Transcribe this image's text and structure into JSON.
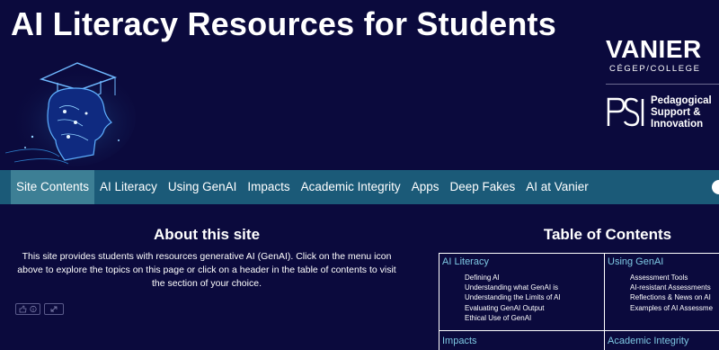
{
  "header": {
    "title": "AI Literacy Resources for Students"
  },
  "brand": {
    "vanier_word": "VANIER",
    "vanier_sub": "CÉGEP/COLLEGE",
    "psi_line1": "Pedagogical",
    "psi_line2": "Support &",
    "psi_line3": "Innovation"
  },
  "nav": {
    "items": [
      "Site Contents",
      "AI Literacy",
      "Using GenAI",
      "Impacts",
      "Academic Integrity",
      "Apps",
      "Deep Fakes",
      "AI at Vanier"
    ]
  },
  "about": {
    "title": "About this site",
    "body": "This site provides students with resources generative AI (GenAI). Click on the menu icon above to explore the topics on this page or click on a header in the table of contents to visit the section of your choice."
  },
  "toc": {
    "title": "Table of Contents",
    "sections": [
      {
        "heading": "AI Literacy",
        "items": [
          "Defining AI",
          "Understanding what GenAI is",
          "Understanding the Limits of AI",
          "Evaluating GenAI Output",
          "Ethical Use of GenAI"
        ]
      },
      {
        "heading": "Using GenAI",
        "items": [
          "Assessment Tools",
          "AI-resistant Assessments",
          "Reflections & News on AI",
          "Examples of AI Assessme"
        ]
      },
      {
        "heading": "Impacts",
        "items": []
      },
      {
        "heading": "Academic Integrity",
        "items": []
      }
    ]
  },
  "colors": {
    "background": "#0b0a3d",
    "navbar": "#1b5a78",
    "nav_active": "#3d7f95",
    "toc_heading": "#7ec8e3"
  },
  "icons": [
    "ai-head-hero-image",
    "thumbs-up-icon",
    "info-icon",
    "expand-icon",
    "menu-toggle-icon"
  ]
}
